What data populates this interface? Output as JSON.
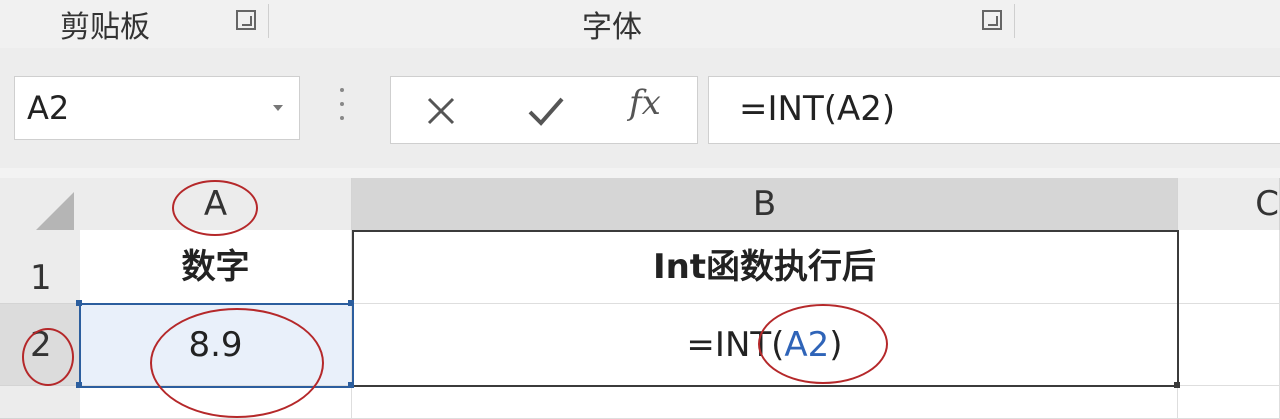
{
  "ribbon": {
    "clipboard_label": "剪贴板",
    "font_label": "字体"
  },
  "formula_bar": {
    "name_box": "A2",
    "cancel_icon": "close-icon",
    "enter_icon": "check-icon",
    "fx_label": "fx",
    "formula": "=INT(A2)"
  },
  "sheet": {
    "columns": [
      "A",
      "B",
      "C"
    ],
    "rows": [
      "1",
      "2"
    ],
    "cells": {
      "A1": "数字",
      "B1": "Int函数执行后",
      "A2": "8.9",
      "B2_prefix": "=INT",
      "B2_open": "(",
      "B2_ref": "A2",
      "B2_close": ")"
    }
  },
  "colors": {
    "selection": "#2c5e9e",
    "annotation": "#b5282a",
    "reference": "#2f64b8"
  }
}
